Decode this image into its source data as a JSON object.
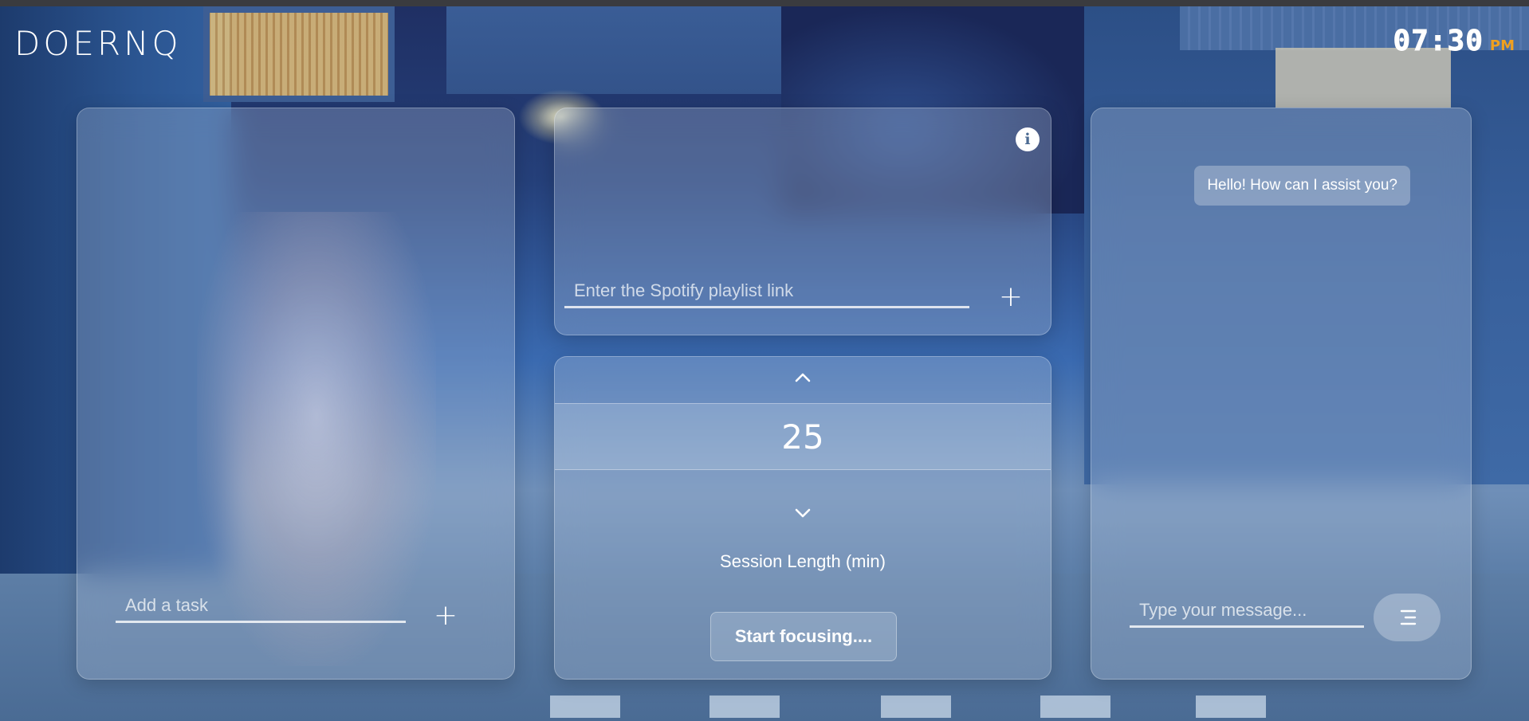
{
  "header": {
    "logo_text": "DOERNQ",
    "clock_time": "07:30",
    "clock_ampm": "PM"
  },
  "colors": {
    "accent": "#f0a020",
    "panel_glass": "rgba(190,205,225,0.28)"
  },
  "tasks": {
    "input_placeholder": "Add a task",
    "add_icon": "plus-icon"
  },
  "spotify": {
    "info_icon": "info-icon",
    "input_placeholder": "Enter the Spotify playlist link",
    "add_icon": "plus-icon"
  },
  "timer": {
    "up_icon": "chevron-up-icon",
    "value": "25",
    "down_icon": "chevron-down-icon",
    "label": "Session Length (min)",
    "start_label": "Start focusing...."
  },
  "chat": {
    "greeting": "Hello! How can I assist you?",
    "input_placeholder": "Type your message...",
    "send_icon": "menu-lines-icon"
  }
}
